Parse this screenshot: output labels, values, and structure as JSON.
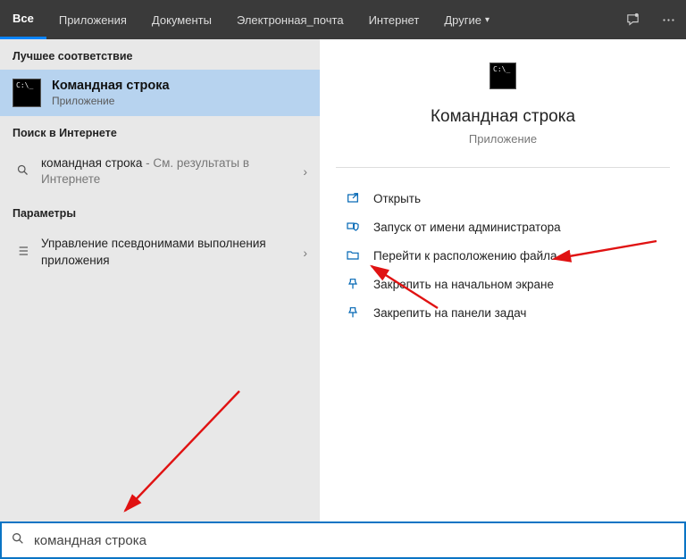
{
  "topbar": {
    "tabs": [
      {
        "label": "Все",
        "active": true
      },
      {
        "label": "Приложения"
      },
      {
        "label": "Документы"
      },
      {
        "label": "Электронная_почта"
      },
      {
        "label": "Интернет"
      },
      {
        "label": "Другие",
        "dropdown": true
      }
    ]
  },
  "left": {
    "best_match_label": "Лучшее соответствие",
    "best_item": {
      "title": "Командная строка",
      "subtitle": "Приложение"
    },
    "web_label": "Поиск в Интернете",
    "web_item": {
      "query": "командная строка",
      "suffix": " - См. результаты в Интернете"
    },
    "params_label": "Параметры",
    "params_item": "Управление псевдонимами выполнения приложения"
  },
  "right": {
    "title": "Командная строка",
    "subtitle": "Приложение",
    "actions": [
      "Открыть",
      "Запуск от имени администратора",
      "Перейти к расположению файла",
      "Закрепить на начальном экране",
      "Закрепить на панели задач"
    ]
  },
  "search": {
    "value": "командная строка"
  }
}
